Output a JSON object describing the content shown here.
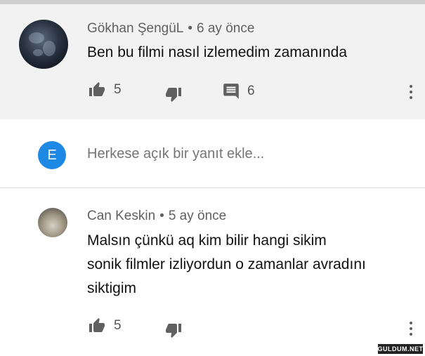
{
  "comments": [
    {
      "author": "Gökhan ŞengüL",
      "separator": "•",
      "time": "6 ay önce",
      "text": "Ben bu filmi nasıl izlemedim zamanında",
      "likes": "5",
      "replies": "6"
    },
    {
      "author": "Can Keskin",
      "separator": "•",
      "time": "5 ay önce",
      "text_lines": [
        "Malsın çünkü aq kim bilir hangi sikim",
        "sonik filmler izliyordun o zamanlar avradını",
        "siktigim"
      ],
      "likes": "5"
    }
  ],
  "reply_box": {
    "avatar_letter": "E",
    "placeholder": "Herkese açık bir yanıt ekle..."
  },
  "watermark": "GULDUM.NET",
  "icons": [
    "thumb-up-icon",
    "thumb-down-icon",
    "reply-icon",
    "more-vert-icon"
  ],
  "colors": {
    "avatar_e": "#1e88e5",
    "highlight_bg": "#f2f2f2",
    "icon_gray": "#606060"
  }
}
